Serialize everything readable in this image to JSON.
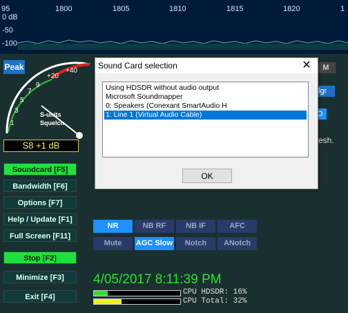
{
  "spectrum": {
    "freq_labels": [
      "95",
      "1800",
      "1805",
      "1810",
      "1815",
      "1820",
      "1"
    ],
    "db_labels": [
      "0 dB",
      "-50",
      "-100"
    ]
  },
  "meter": {
    "peak_label": "Peak",
    "scale_labels": [
      "+40",
      "+20",
      "9",
      "7",
      "5",
      "3",
      "1"
    ],
    "caption_line1": "S-units",
    "caption_line2": "Squelch",
    "readout": "S8 +1 dB"
  },
  "buttons": [
    {
      "label": "Soundcard   [F5]",
      "state": "on"
    },
    {
      "label": "Bandwidth  [F6]",
      "state": "off"
    },
    {
      "label": "Options    [F7]",
      "state": "off"
    },
    {
      "label": "Help / Update  [F1]",
      "state": "off"
    },
    {
      "label": "Full Screen  [F11]",
      "state": "off"
    },
    {
      "label": "Stop         [F2]",
      "state": "on"
    },
    {
      "label": "Minimize   [F3]",
      "state": "off"
    },
    {
      "label": "Exit          [F4]",
      "state": "off"
    }
  ],
  "dsp": {
    "row1": [
      {
        "label": "NR",
        "state": "on"
      },
      {
        "label": "NB RF",
        "state": "off"
      },
      {
        "label": "NB IF",
        "state": "off"
      },
      {
        "label": "AFC",
        "state": "off"
      }
    ],
    "row2": [
      {
        "label": "Mute",
        "state": "off"
      },
      {
        "label": "AGC Slow",
        "state": "on"
      },
      {
        "label": "Notch",
        "state": "off"
      },
      {
        "label": "ANotch",
        "state": "off"
      }
    ]
  },
  "clock": "4/05/2017  8:11:39 PM",
  "cpu": {
    "hdsdr_label": "CPU HDSDR: 16%",
    "hdsdr_value": 16,
    "total_label": "CPU Total: 32%",
    "total_value": 32
  },
  "partials": {
    "right_top": "lgr",
    "right_mid": "O",
    "right_text": "esh.",
    "right_icon": "M"
  },
  "dialog": {
    "title": "Sound Card selection",
    "close_glyph": "✕",
    "items": [
      "Using HDSDR without audio output",
      "Microsoft Soundmapper",
      "0: Speakers (Conexant SmartAudio H",
      "1: Line 1 (Virtual Audio Cable)"
    ],
    "selected_index": 3,
    "ok_label": "OK"
  },
  "colors": {
    "accent_blue": "#1e90ff",
    "green_on": "#20e040",
    "selection": "#0078d7"
  }
}
